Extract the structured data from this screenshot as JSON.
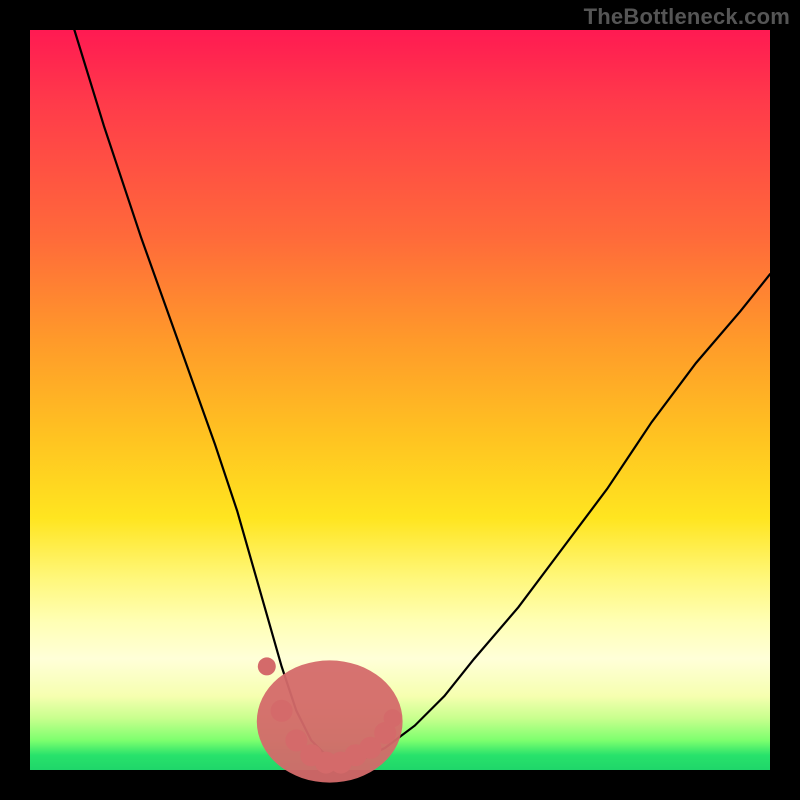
{
  "watermark": "TheBottleneck.com",
  "chart_data": {
    "type": "line",
    "title": "",
    "xlabel": "",
    "ylabel": "",
    "xlim": [
      0,
      100
    ],
    "ylim": [
      0,
      100
    ],
    "grid": false,
    "legend": false,
    "background_gradient": {
      "direction": "vertical",
      "stops": [
        {
          "pos": 0.0,
          "color": "#ff1a52"
        },
        {
          "pos": 0.28,
          "color": "#ff6a3a"
        },
        {
          "pos": 0.55,
          "color": "#ffc321"
        },
        {
          "pos": 0.74,
          "color": "#fff77a"
        },
        {
          "pos": 0.9,
          "color": "#f6ffb0"
        },
        {
          "pos": 0.98,
          "color": "#28e26b"
        },
        {
          "pos": 1.0,
          "color": "#1fd66a"
        }
      ]
    },
    "series": [
      {
        "name": "bottleneck-curve",
        "x": [
          6,
          10,
          15,
          20,
          25,
          28,
          30,
          32,
          34,
          36,
          38,
          40,
          42,
          44,
          46,
          48,
          52,
          56,
          60,
          66,
          72,
          78,
          84,
          90,
          96,
          100
        ],
        "y": [
          100,
          87,
          72,
          58,
          44,
          35,
          28,
          21,
          14,
          8,
          4,
          2,
          1,
          1,
          2,
          3,
          6,
          10,
          15,
          22,
          30,
          38,
          47,
          55,
          62,
          67
        ]
      }
    ],
    "markers": {
      "name": "highlight-points",
      "color": "#d46a6a",
      "x": [
        32,
        34,
        36,
        38,
        40,
        42,
        44,
        46,
        48,
        49
      ],
      "y": [
        14,
        8,
        4,
        2,
        1,
        1,
        2,
        3,
        5,
        7
      ]
    },
    "optimum_x": 42,
    "optimum_y": 1
  }
}
